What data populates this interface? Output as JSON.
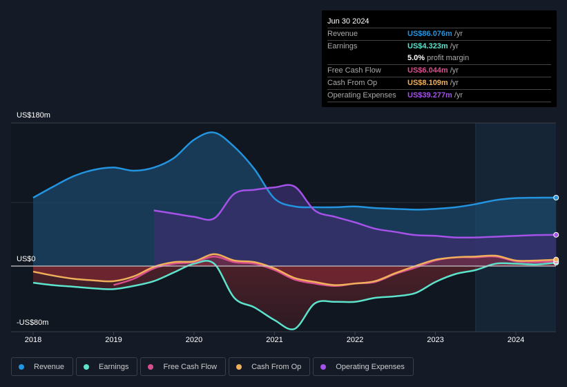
{
  "tooltip": {
    "date": "Jun 30 2024",
    "rows": [
      {
        "label": "Revenue",
        "value": "US$86.076m",
        "unit": "/yr",
        "color": "#2394df"
      },
      {
        "label": "Earnings",
        "value": "US$4.323m",
        "unit": "/yr",
        "color": "#5ce3cc"
      },
      {
        "label": "",
        "value": "5.0%",
        "unit": "profit margin",
        "color": "#ffffff"
      },
      {
        "label": "Free Cash Flow",
        "value": "US$6.044m",
        "unit": "/yr",
        "color": "#d84f8f"
      },
      {
        "label": "Cash From Op",
        "value": "US$8.109m",
        "unit": "/yr",
        "color": "#f0b05a"
      },
      {
        "label": "Operating Expenses",
        "value": "US$39.277m",
        "unit": "/yr",
        "color": "#a452e8"
      }
    ]
  },
  "legend": [
    {
      "label": "Revenue",
      "color": "#2394df"
    },
    {
      "label": "Earnings",
      "color": "#5ce3cc"
    },
    {
      "label": "Free Cash Flow",
      "color": "#d84f8f"
    },
    {
      "label": "Cash From Op",
      "color": "#f0b05a"
    },
    {
      "label": "Operating Expenses",
      "color": "#a452e8"
    }
  ],
  "chart_data": {
    "type": "area",
    "title": "",
    "xlabel": "",
    "ylabel": "",
    "ylim": [
      -80,
      180
    ],
    "xlim": [
      2017.75,
      2024.5
    ],
    "y_tick_labels": [
      {
        "value": 180,
        "label": "US$180m"
      },
      {
        "value": 0,
        "label": "US$0"
      },
      {
        "value": -80,
        "label": "-US$80m"
      }
    ],
    "x_tick_labels": [
      "2018",
      "2019",
      "2020",
      "2021",
      "2022",
      "2023",
      "2024"
    ],
    "x_ticks": [
      2018,
      2019,
      2020,
      2021,
      2022,
      2023,
      2024
    ],
    "forecast_shade_start": 2023.5,
    "series": [
      {
        "name": "Revenue",
        "color": "#2394df",
        "points": [
          [
            2018,
            86
          ],
          [
            2018.25,
            100
          ],
          [
            2018.5,
            113
          ],
          [
            2018.75,
            121
          ],
          [
            2019,
            124
          ],
          [
            2019.25,
            120
          ],
          [
            2019.5,
            124
          ],
          [
            2019.75,
            136
          ],
          [
            2020,
            159
          ],
          [
            2020.25,
            168
          ],
          [
            2020.5,
            150
          ],
          [
            2020.75,
            122
          ],
          [
            2021,
            85
          ],
          [
            2021.25,
            75
          ],
          [
            2021.5,
            74
          ],
          [
            2021.75,
            74
          ],
          [
            2022,
            75
          ],
          [
            2022.25,
            73
          ],
          [
            2022.5,
            72
          ],
          [
            2022.75,
            71
          ],
          [
            2023,
            72
          ],
          [
            2023.25,
            74
          ],
          [
            2023.5,
            78
          ],
          [
            2023.75,
            83
          ],
          [
            2024,
            85.5
          ],
          [
            2024.25,
            86
          ],
          [
            2024.5,
            86.076
          ]
        ]
      },
      {
        "name": "Operating Expenses",
        "color": "#a452e8",
        "points": [
          [
            2019.5,
            70
          ],
          [
            2019.75,
            66
          ],
          [
            2020,
            62
          ],
          [
            2020.25,
            60
          ],
          [
            2020.5,
            91
          ],
          [
            2020.75,
            96
          ],
          [
            2021,
            99
          ],
          [
            2021.25,
            100
          ],
          [
            2021.5,
            70
          ],
          [
            2021.75,
            62
          ],
          [
            2022,
            55
          ],
          [
            2022.25,
            47
          ],
          [
            2022.5,
            43
          ],
          [
            2022.75,
            39
          ],
          [
            2023,
            38
          ],
          [
            2023.25,
            36
          ],
          [
            2023.5,
            36
          ],
          [
            2023.75,
            37
          ],
          [
            2024,
            38
          ],
          [
            2024.25,
            39
          ],
          [
            2024.5,
            39.277
          ]
        ]
      },
      {
        "name": "Earnings",
        "color": "#5ce3cc",
        "points": [
          [
            2018,
            -21
          ],
          [
            2018.25,
            -24
          ],
          [
            2018.5,
            -26
          ],
          [
            2018.75,
            -28
          ],
          [
            2019,
            -29
          ],
          [
            2019.25,
            -25
          ],
          [
            2019.5,
            -19
          ],
          [
            2019.75,
            -8
          ],
          [
            2020,
            3
          ],
          [
            2020.25,
            3
          ],
          [
            2020.5,
            -40
          ],
          [
            2020.75,
            -52
          ],
          [
            2021,
            -68
          ],
          [
            2021.25,
            -79
          ],
          [
            2021.5,
            -47
          ],
          [
            2021.75,
            -45
          ],
          [
            2022,
            -45
          ],
          [
            2022.25,
            -40
          ],
          [
            2022.5,
            -38
          ],
          [
            2022.75,
            -34
          ],
          [
            2023,
            -20
          ],
          [
            2023.25,
            -10
          ],
          [
            2023.5,
            -5
          ],
          [
            2023.75,
            3
          ],
          [
            2024,
            3
          ],
          [
            2024.25,
            2
          ],
          [
            2024.5,
            4.323
          ]
        ]
      },
      {
        "name": "Free Cash Flow",
        "color": "#d84f8f",
        "points": [
          [
            2019,
            -24
          ],
          [
            2019.25,
            -16
          ],
          [
            2019.5,
            -3
          ],
          [
            2019.75,
            3
          ],
          [
            2020,
            5
          ],
          [
            2020.25,
            12
          ],
          [
            2020.5,
            5
          ],
          [
            2020.75,
            3
          ],
          [
            2021,
            -5
          ],
          [
            2021.25,
            -17
          ],
          [
            2021.5,
            -22
          ],
          [
            2021.75,
            -25
          ],
          [
            2022,
            -22
          ],
          [
            2022.25,
            -20
          ],
          [
            2022.5,
            -10
          ],
          [
            2022.75,
            -2
          ],
          [
            2023,
            7
          ],
          [
            2023.25,
            11
          ],
          [
            2023.5,
            11
          ],
          [
            2023.75,
            12
          ],
          [
            2024,
            6
          ],
          [
            2024.25,
            5
          ],
          [
            2024.5,
            6.044
          ]
        ]
      },
      {
        "name": "Cash From Op",
        "color": "#f0b05a",
        "points": [
          [
            2018,
            -7
          ],
          [
            2018.25,
            -12
          ],
          [
            2018.5,
            -16
          ],
          [
            2018.75,
            -18
          ],
          [
            2019,
            -19
          ],
          [
            2019.25,
            -13
          ],
          [
            2019.5,
            -1
          ],
          [
            2019.75,
            5
          ],
          [
            2020,
            6
          ],
          [
            2020.25,
            15
          ],
          [
            2020.5,
            7
          ],
          [
            2020.75,
            5
          ],
          [
            2021,
            -3
          ],
          [
            2021.25,
            -15
          ],
          [
            2021.5,
            -20
          ],
          [
            2021.75,
            -24
          ],
          [
            2022,
            -22
          ],
          [
            2022.25,
            -19
          ],
          [
            2022.5,
            -9
          ],
          [
            2022.75,
            0
          ],
          [
            2023,
            8
          ],
          [
            2023.25,
            11
          ],
          [
            2023.5,
            12
          ],
          [
            2023.75,
            13
          ],
          [
            2024,
            7
          ],
          [
            2024.25,
            7
          ],
          [
            2024.5,
            8.109
          ]
        ]
      }
    ]
  }
}
